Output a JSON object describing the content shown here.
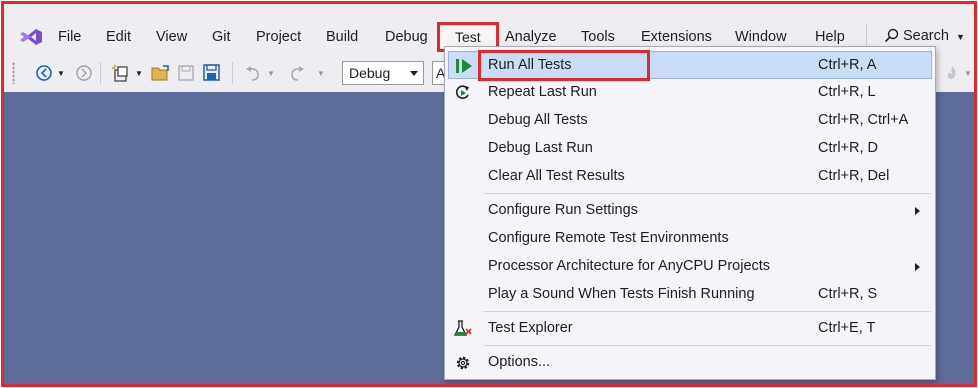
{
  "menubar": {
    "items": [
      {
        "label": "File"
      },
      {
        "label": "Edit"
      },
      {
        "label": "View"
      },
      {
        "label": "Git"
      },
      {
        "label": "Project"
      },
      {
        "label": "Build"
      },
      {
        "label": "Debug"
      },
      {
        "label": "Test"
      },
      {
        "label": "Analyze"
      },
      {
        "label": "Tools"
      },
      {
        "label": "Extensions"
      },
      {
        "label": "Window"
      },
      {
        "label": "Help"
      }
    ],
    "search_label": "Search"
  },
  "toolbar": {
    "config_value": "Debug",
    "platform_partial": "A"
  },
  "test_menu": {
    "items": [
      {
        "label": "Run All Tests",
        "shortcut": "Ctrl+R, A"
      },
      {
        "label": "Repeat Last Run",
        "shortcut": "Ctrl+R, L"
      },
      {
        "label": "Debug All Tests",
        "shortcut": "Ctrl+R, Ctrl+A"
      },
      {
        "label": "Debug Last Run",
        "shortcut": "Ctrl+R, D"
      },
      {
        "label": "Clear All Test Results",
        "shortcut": "Ctrl+R, Del"
      },
      {
        "label": "Configure Run Settings",
        "shortcut": ""
      },
      {
        "label": "Configure Remote Test Environments",
        "shortcut": ""
      },
      {
        "label": "Processor Architecture for AnyCPU Projects",
        "shortcut": ""
      },
      {
        "label": "Play a Sound When Tests Finish Running",
        "shortcut": "Ctrl+R, S"
      },
      {
        "label": "Test Explorer",
        "shortcut": "Ctrl+E, T"
      },
      {
        "label": "Options...",
        "shortcut": ""
      }
    ]
  },
  "colors": {
    "highlight_frame": "#e0282e",
    "workspace": "#5d6b99",
    "menu_hover": "#c9ddf6",
    "vs_purple": "#7b4fc9"
  },
  "icons": {
    "logo": "visual-studio-logo",
    "run_all": "run-all-tests-icon",
    "repeat": "repeat-run-icon",
    "test_explorer": "test-explorer-icon",
    "options": "gear-icon"
  }
}
